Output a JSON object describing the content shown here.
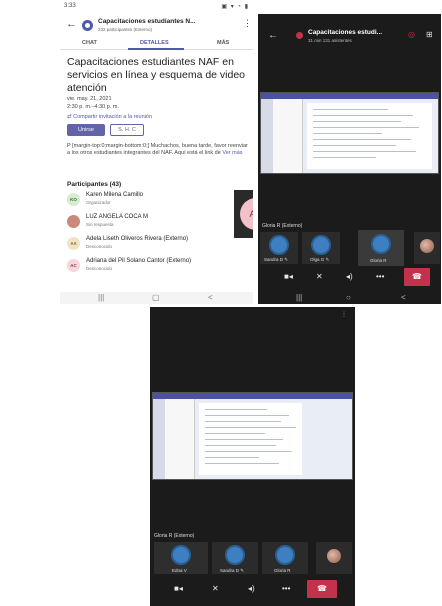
{
  "panel1": {
    "status_time": "3:33",
    "status_icons": "▣ ▾ ◔ ▮",
    "header_title": "Capacitaciones estudiantes N...",
    "header_subtitle": "232 participantes (Externo)",
    "tabs": [
      "CHAT",
      "DETALLES",
      "MÁS"
    ],
    "meeting_title": "Capacitaciones estudiantes NAF en servicios en línea y esquema de video atención",
    "date": "vie. may. 21, 2021",
    "time": "2:30 p. m.–4:30 p. m.",
    "share_link": "Compartir invitación a la reunión",
    "join_button": "Unirse",
    "shc_button": "S. H. C",
    "description": "P [margin-top:0;margin-bottom:0;] Muchachos, buena tarde, favor reenviar a los otros estudiantes integrantes del NAF. Aquí está el link de",
    "description_more": "Ver más",
    "participants_heading": "Participantes (43)",
    "participants": [
      {
        "initials": "KO",
        "name": "Karen Milena Camillo",
        "role": "Organizador",
        "bg": "#d9ead3",
        "fg": "#3b6b2f"
      },
      {
        "initials": "",
        "name": "LUZ ANGELA COCA M",
        "role": "Sin respuesta",
        "bg": "#c98a7a",
        "fg": "#fff"
      },
      {
        "initials": "AX",
        "name": "Adela Liseth Oliveros Rivera (Externo)",
        "role": "Desconocido",
        "bg": "#f1e3c6",
        "fg": "#8a6a2a"
      },
      {
        "initials": "AC",
        "name": "Adriana del Pil Solano Cantor (Externo)",
        "role": "Desconocido",
        "bg": "#f6d6dc",
        "fg": "#8a3b4a"
      }
    ],
    "ag_tile_initials": "AG"
  },
  "panel2": {
    "title": "Capacitaciones estudi...",
    "subtitle": "31 min   131 asistentes",
    "presenter": "Gloria R (Externo)",
    "attendees": [
      "Sandra D ✎",
      "Olga G ✎",
      "Gloria R"
    ]
  },
  "panel3": {
    "presenter": "Gloria R (Externo)",
    "attendees": [
      "Edna V",
      "Sandra D ✎",
      "Gloria R"
    ]
  },
  "controls": {
    "camera": "■◂",
    "mic": "🎙",
    "speaker": "◂)",
    "more": "•••",
    "hangup": "☎"
  },
  "nav": {
    "recents": "|||",
    "home": "○",
    "back": "<"
  },
  "colors": {
    "accent": "#6264a7",
    "hangup": "#c4314b",
    "attendee_circle": "#3d7fc0"
  }
}
